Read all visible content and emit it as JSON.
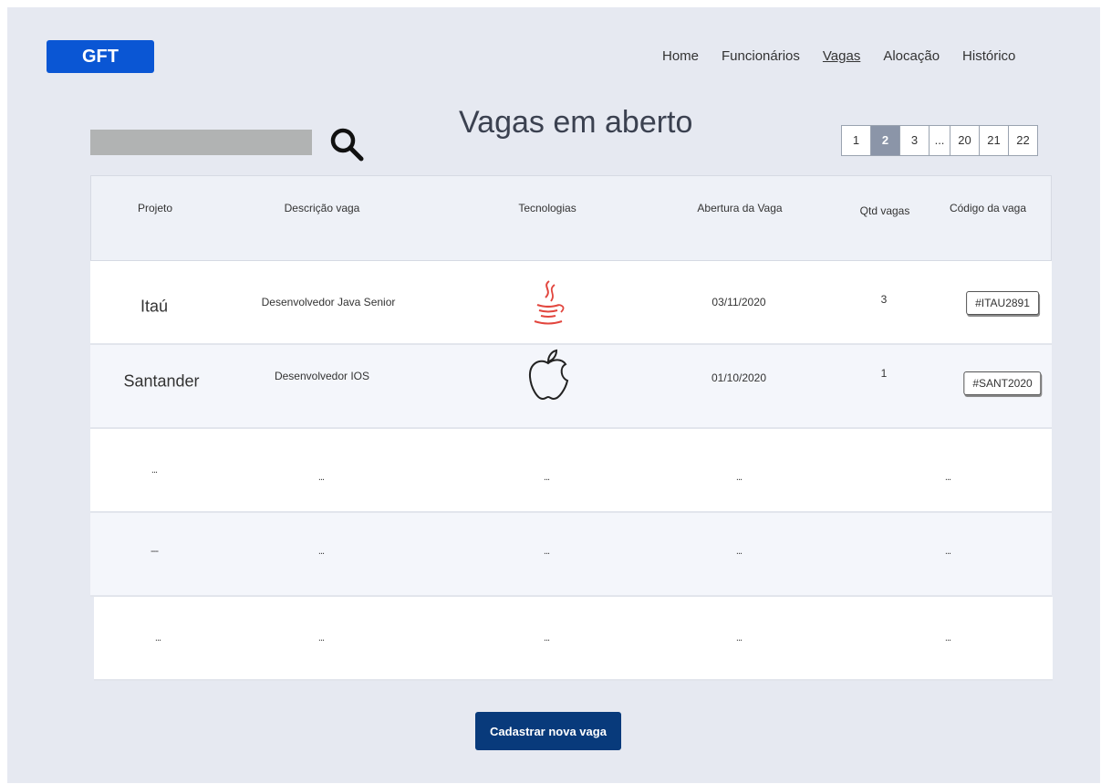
{
  "header": {
    "logo": "GFT",
    "nav": [
      {
        "label": "Home",
        "active": false
      },
      {
        "label": "Funcionários",
        "active": false
      },
      {
        "label": "Vagas",
        "active": true
      },
      {
        "label": "Alocação",
        "active": false
      },
      {
        "label": "Histórico",
        "active": false
      }
    ]
  },
  "search": {
    "placeholder": "",
    "value": "",
    "icon": "magnifier-icon"
  },
  "page_title": "Vagas em aberto",
  "pagination": {
    "pages": [
      "1",
      "2",
      "3",
      "...",
      "20",
      "21",
      "22"
    ],
    "current": "2"
  },
  "table": {
    "columns": [
      "Projeto",
      "Descrição vaga",
      "Tecnologias",
      "Abertura da Vaga",
      "Qtd vagas",
      "Código da vaga"
    ],
    "rows": [
      {
        "projeto": "Itaú",
        "descricao": "Desenvolvedor Java Senior",
        "tecnologia": "java-icon",
        "abertura": "03/11/2020",
        "qtd": "3",
        "codigo": "#ITAU2891"
      },
      {
        "projeto": "Santander",
        "descricao": "Desenvolvedor IOS",
        "tecnologia": "apple-icon",
        "abertura": "01/10/2020",
        "qtd": "1",
        "codigo": "#SANT2020"
      }
    ],
    "placeholder_rows": [
      [
        "...",
        "...",
        "...",
        "...",
        "..."
      ],
      [
        "---",
        "...",
        "...",
        "...",
        "..."
      ],
      [
        "...",
        "...",
        "...",
        "...",
        "..."
      ]
    ]
  },
  "actions": {
    "new_job_label": "Cadastrar nova vaga"
  },
  "colors": {
    "brand": "#0a56d4",
    "primary_button": "#083a7b",
    "page_active": "#8b95a8",
    "java_red": "#e2463e"
  }
}
